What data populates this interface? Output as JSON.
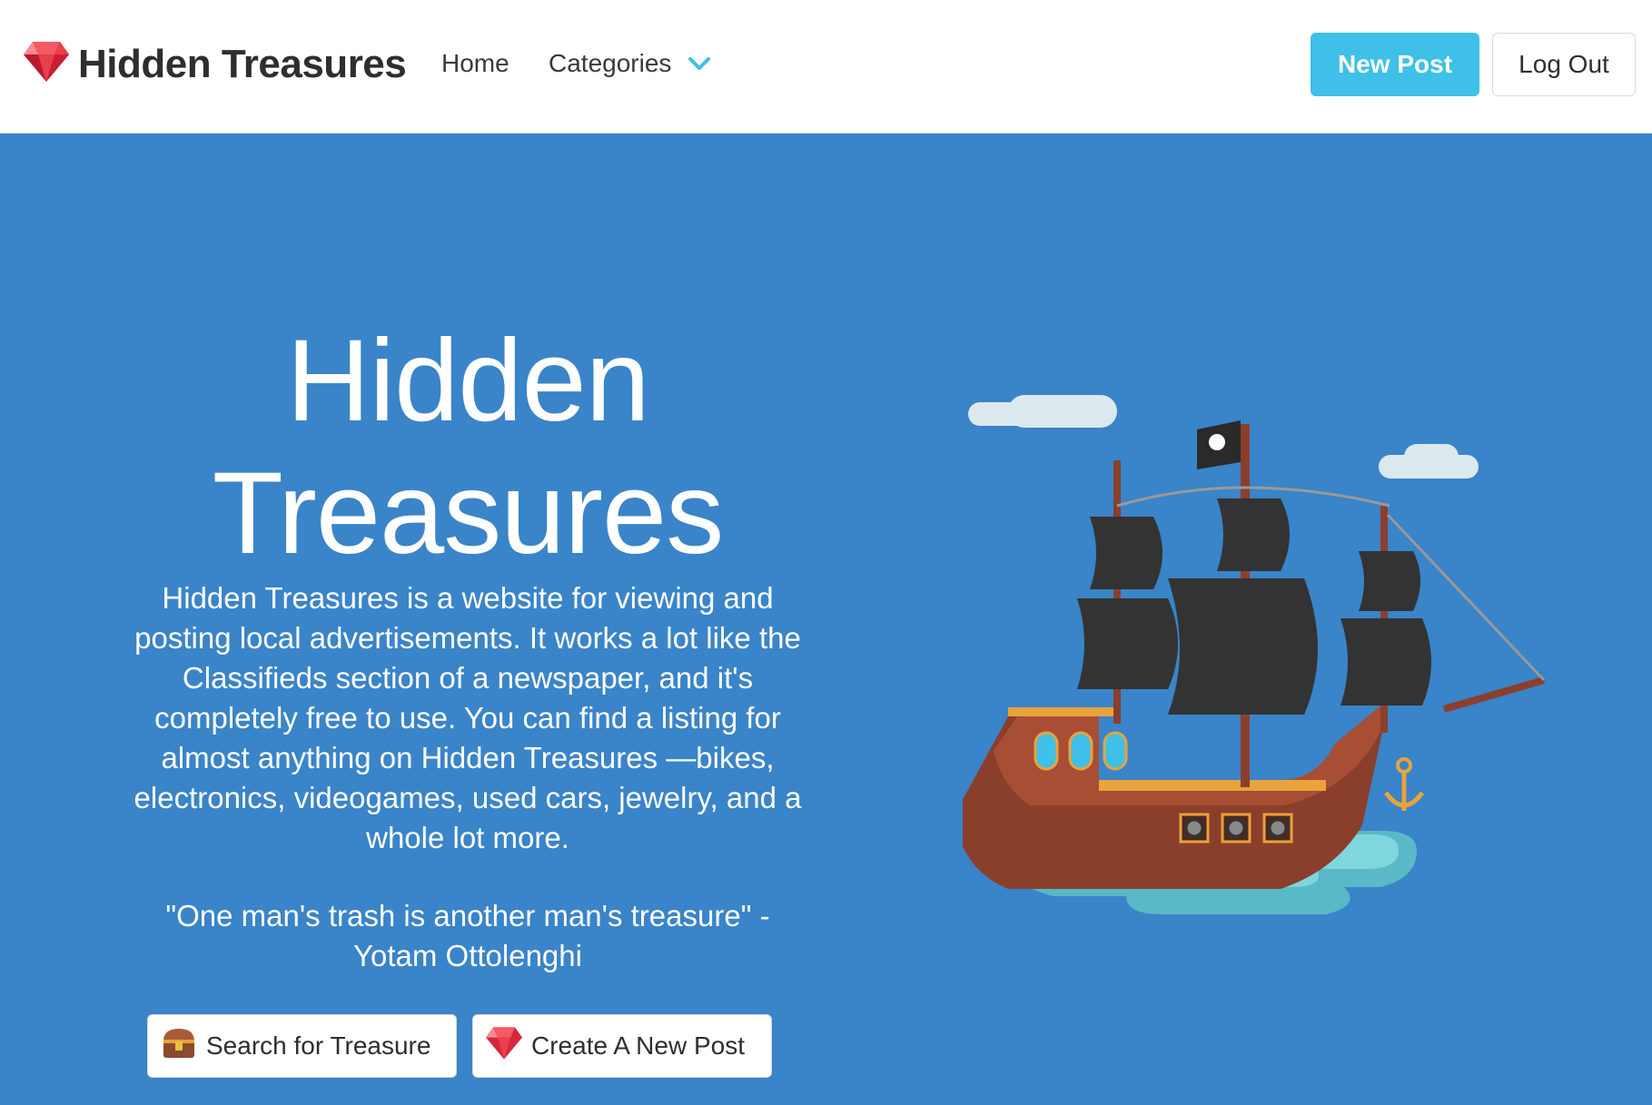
{
  "navbar": {
    "brand_title": "Hidden Treasures",
    "links": {
      "home": "Home",
      "categories": "Categories"
    },
    "new_post_label": "New Post",
    "logout_label": "Log Out"
  },
  "hero": {
    "title_line1": "Hidden",
    "title_line2": "Treasures",
    "description": "Hidden Treasures is a website for viewing and posting local advertisements. It works a lot like the Classifieds section of a newspaper, and it's completely free to use. You can find a listing for almost anything on Hidden Treasures —bikes, electronics, videogames, used cars, jewelry, and a whole lot more.",
    "quote": "\"One man's trash is another man's treasure\" - Yotam Ottolenghi",
    "search_button": "Search for Treasure",
    "create_button": "Create A New Post"
  },
  "colors": {
    "hero_bg": "#3a84c9",
    "primary": "#3ec0e8",
    "gem": "#e0313b"
  },
  "icons": [
    "gem-icon",
    "chevron-down-icon",
    "treasure-chest-icon",
    "pirate-ship-illustration"
  ]
}
